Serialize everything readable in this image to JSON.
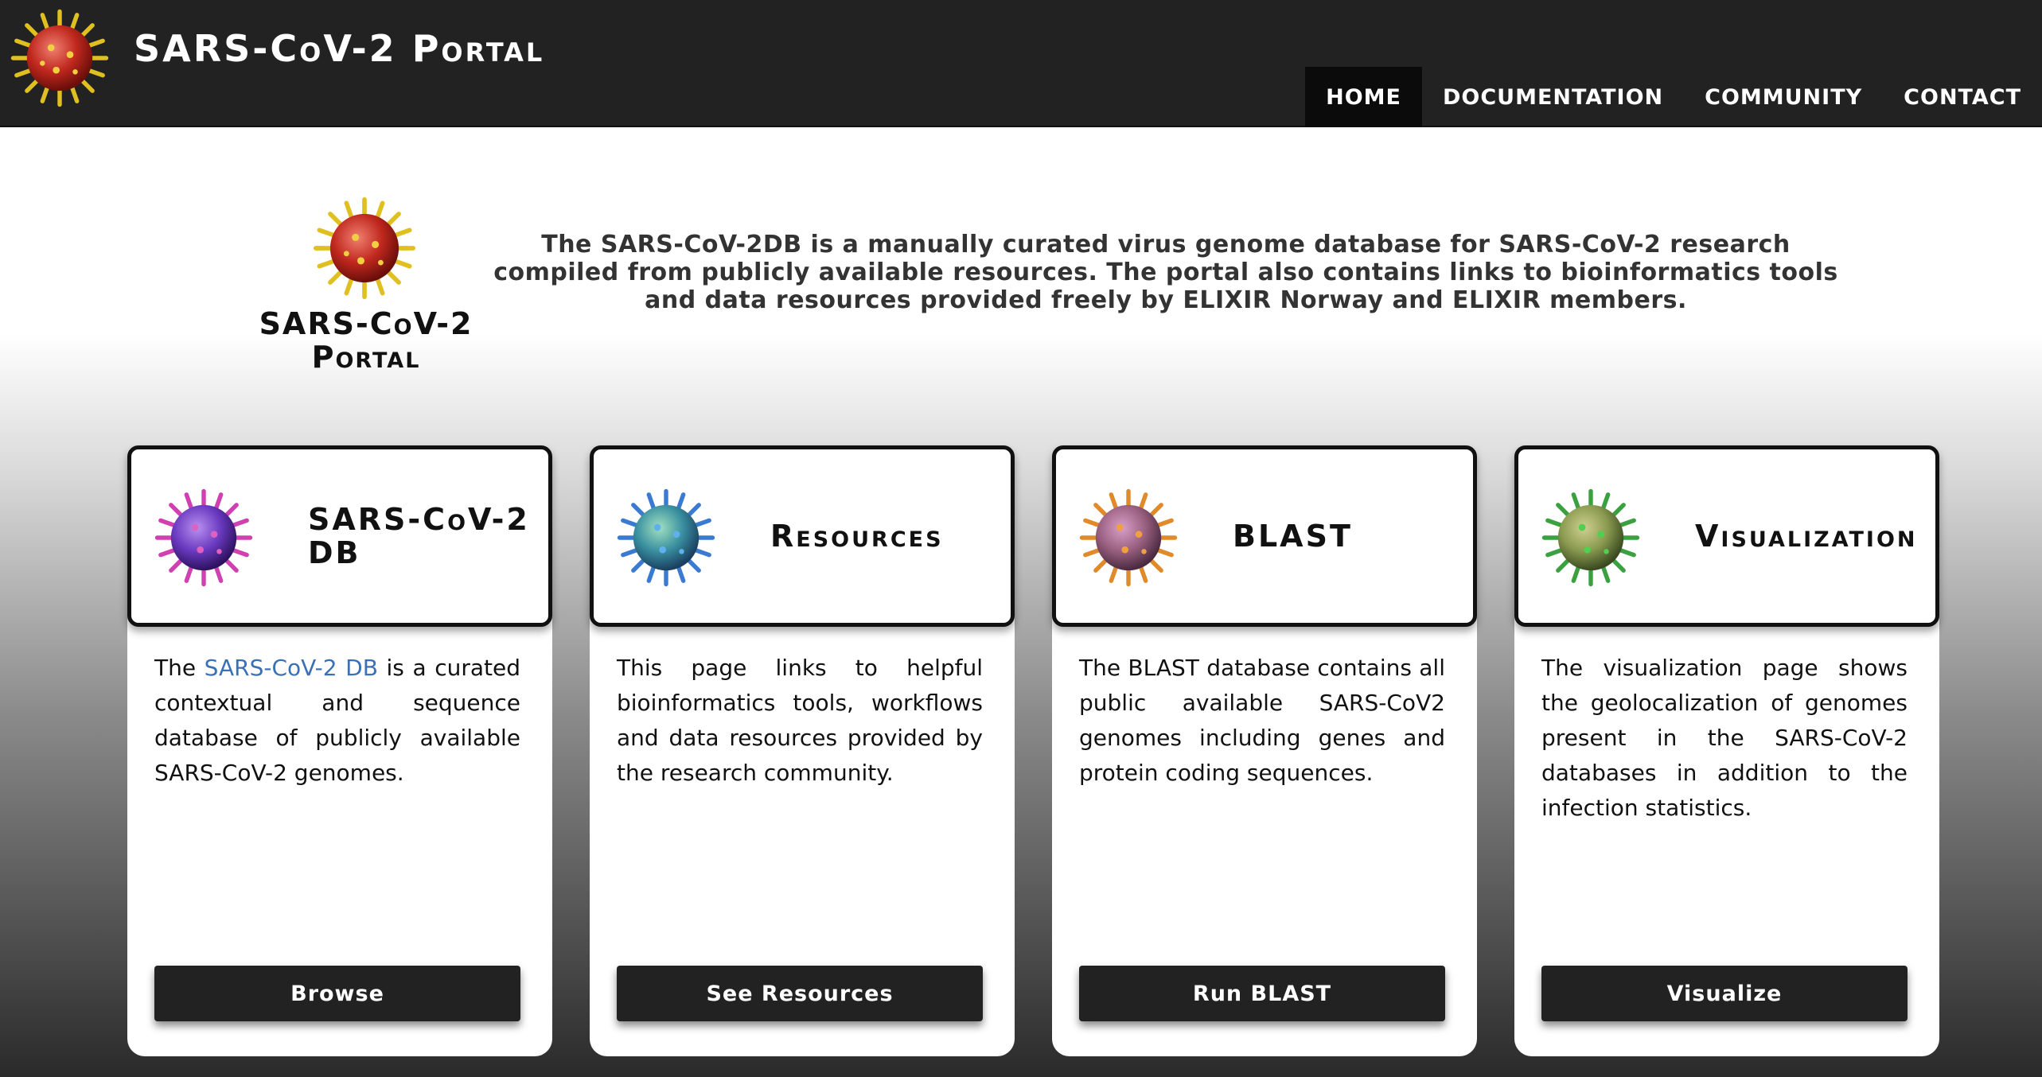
{
  "header": {
    "title": "SARS-CoV-2 Portal",
    "logo_icon": "virus-icon",
    "nav": [
      {
        "label": "HOME",
        "active": true
      },
      {
        "label": "DOCUMENTATION",
        "active": false
      },
      {
        "label": "COMMUNITY",
        "active": false
      },
      {
        "label": "CONTACT",
        "active": false
      }
    ]
  },
  "intro": {
    "logo_title_line1": "SARS-CoV-2",
    "logo_title_line2": "Portal",
    "text": "The SARS-CoV-2DB is a manually curated virus genome database for SARS-CoV-2 research compiled from publicly available resources. The portal also contains links to bioinformatics tools and data resources provided freely by ELIXIR Norway and ELIXIR members."
  },
  "cards": [
    {
      "title": "SARS-CoV-2 DB",
      "icon": "virus-magenta-icon",
      "body_prefix": "The ",
      "body_link": "SARS-CoV-2 DB",
      "body_suffix": " is a curated contextual and sequence database of publicly available SARS-CoV-2 genomes.",
      "button": "Browse"
    },
    {
      "title": "Resources",
      "icon": "virus-blue-icon",
      "body": "This page links to helpful bioinformatics tools, workflows and data resources provided by the research community.",
      "button": "See Resources"
    },
    {
      "title": "BLAST",
      "icon": "virus-orange-icon",
      "body": "The BLAST database contains all public available SARS-CoV2 genomes including genes and protein coding sequences.",
      "button": "Run BLAST"
    },
    {
      "title": "Visualization",
      "icon": "virus-green-icon",
      "body": "The visualization page shows the geolocalization of genomes present in the SARS-CoV-2 databases in addition to the infection statistics.",
      "button": "Visualize"
    }
  ],
  "colors": {
    "header_bg": "#222222",
    "nav_active_bg": "#0b0b0b",
    "link": "#3a70b5",
    "button_bg": "#222222"
  }
}
